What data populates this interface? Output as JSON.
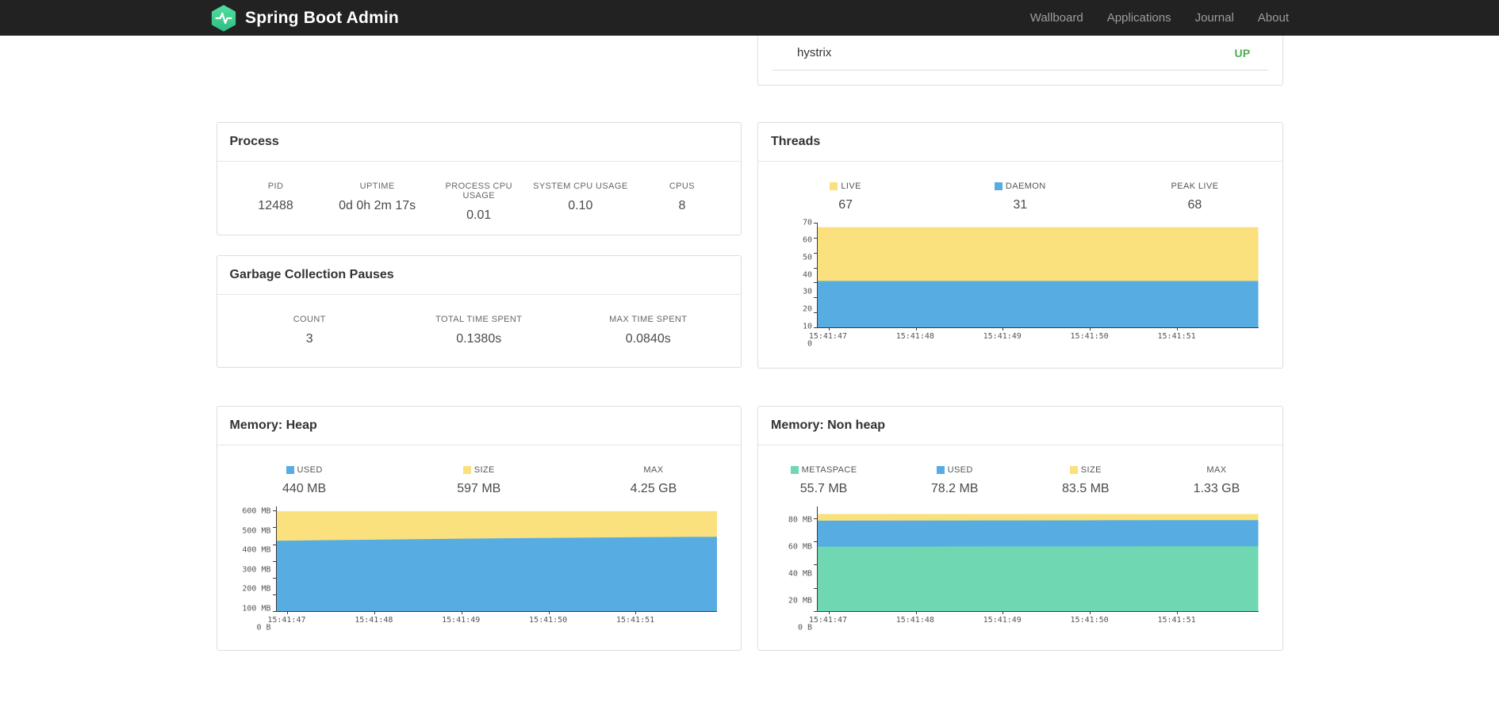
{
  "navbar": {
    "brand": "Spring Boot Admin",
    "logo_color_top": "#4ede9e",
    "logo_color_bottom": "#2fbf83",
    "items": [
      {
        "label": "Wallboard"
      },
      {
        "label": "Applications"
      },
      {
        "label": "Journal"
      },
      {
        "label": "About"
      }
    ]
  },
  "application_panel": {
    "app_name": "hystrix",
    "status": "UP",
    "status_color": "#4caf50"
  },
  "process": {
    "title": "Process",
    "stats": [
      {
        "label": "PID",
        "value": "12488"
      },
      {
        "label": "UPTIME",
        "value": "0d 0h 2m 17s"
      },
      {
        "label": "PROCESS CPU USAGE",
        "value": "0.01"
      },
      {
        "label": "SYSTEM CPU USAGE",
        "value": "0.10"
      },
      {
        "label": "CPUS",
        "value": "8"
      }
    ]
  },
  "gc": {
    "title": "Garbage Collection Pauses",
    "stats": [
      {
        "label": "COUNT",
        "value": "3"
      },
      {
        "label": "TOTAL TIME SPENT",
        "value": "0.1380s"
      },
      {
        "label": "MAX TIME SPENT",
        "value": "0.0840s"
      }
    ]
  },
  "threads": {
    "title": "Threads",
    "legend": [
      {
        "label": "LIVE",
        "value": "67",
        "color": "#fae17d"
      },
      {
        "label": "DAEMON",
        "value": "31",
        "color": "#57ace2"
      },
      {
        "label": "PEAK LIVE",
        "value": "68"
      }
    ]
  },
  "memory_heap": {
    "title": "Memory: Heap",
    "legend": [
      {
        "label": "USED",
        "value": "440 MB",
        "color": "#57ace2"
      },
      {
        "label": "SIZE",
        "value": "597 MB",
        "color": "#fae17d"
      },
      {
        "label": "MAX",
        "value": "4.25 GB"
      }
    ]
  },
  "memory_nonheap": {
    "title": "Memory: Non heap",
    "legend": [
      {
        "label": "METASPACE",
        "value": "55.7 MB",
        "color": "#6fd8b2"
      },
      {
        "label": "USED",
        "value": "78.2 MB",
        "color": "#57ace2"
      },
      {
        "label": "SIZE",
        "value": "83.5 MB",
        "color": "#fae17d"
      },
      {
        "label": "MAX",
        "value": "1.33 GB"
      }
    ]
  },
  "chart_data": [
    {
      "id": "threads",
      "type": "area",
      "title": "Threads",
      "stacked": true,
      "legend_position": "top",
      "grid": false,
      "y_max": 70,
      "y_ticks": [
        {
          "label": "0",
          "value": 0
        },
        {
          "label": "10",
          "value": 10
        },
        {
          "label": "20",
          "value": 20
        },
        {
          "label": "30",
          "value": 30
        },
        {
          "label": "40",
          "value": 40
        },
        {
          "label": "50",
          "value": 50
        },
        {
          "label": "60",
          "value": 60
        },
        {
          "label": "70",
          "value": 70
        }
      ],
      "x_tick_labels": [
        "15:41:47",
        "15:41:48",
        "15:41:49",
        "15:41:50",
        "15:41:51"
      ],
      "x_tick_positions": [
        0.025,
        0.2225,
        0.42,
        0.6175,
        0.815
      ],
      "series": [
        {
          "name": "DAEMON",
          "color": "#57ace2",
          "values": [
            31,
            31,
            31,
            31,
            31,
            31
          ]
        },
        {
          "name": "LIVE",
          "color": "#fae17d",
          "values": [
            67,
            67,
            67,
            67,
            67,
            67
          ]
        }
      ]
    },
    {
      "id": "memory-heap",
      "type": "area",
      "title": "Memory: Heap",
      "stacked": true,
      "legend_position": "top",
      "grid": false,
      "y_max": 625,
      "y_ticks": [
        {
          "label": "0 B",
          "value": 0
        },
        {
          "label": "100 MB",
          "value": 100
        },
        {
          "label": "200 MB",
          "value": 200
        },
        {
          "label": "300 MB",
          "value": 300
        },
        {
          "label": "400 MB",
          "value": 400
        },
        {
          "label": "500 MB",
          "value": 500
        },
        {
          "label": "600 MB",
          "value": 600
        }
      ],
      "x_tick_labels": [
        "15:41:47",
        "15:41:48",
        "15:41:49",
        "15:41:50",
        "15:41:51"
      ],
      "x_tick_positions": [
        0.025,
        0.2225,
        0.42,
        0.6175,
        0.815
      ],
      "series": [
        {
          "name": "USED",
          "color": "#57ace2",
          "values": [
            420,
            426,
            432,
            437,
            441,
            444
          ]
        },
        {
          "name": "SIZE",
          "color": "#fae17d",
          "values": [
            597,
            597,
            597,
            597,
            597,
            597
          ]
        }
      ]
    },
    {
      "id": "memory-nonheap",
      "type": "area",
      "title": "Memory: Non heap",
      "stacked": true,
      "legend_position": "top",
      "grid": false,
      "y_max": 90,
      "y_ticks": [
        {
          "label": "0 B",
          "value": 0
        },
        {
          "label": "20 MB",
          "value": 20
        },
        {
          "label": "40 MB",
          "value": 40
        },
        {
          "label": "60 MB",
          "value": 60
        },
        {
          "label": "80 MB",
          "value": 80
        }
      ],
      "x_tick_labels": [
        "15:41:47",
        "15:41:48",
        "15:41:49",
        "15:41:50",
        "15:41:51"
      ],
      "x_tick_positions": [
        0.025,
        0.2225,
        0.42,
        0.6175,
        0.815
      ],
      "series": [
        {
          "name": "METASPACE",
          "color": "#6fd8b2",
          "values": [
            55.4,
            55.5,
            55.6,
            55.6,
            55.7,
            55.7
          ]
        },
        {
          "name": "USED",
          "color": "#57ace2",
          "values": [
            77.8,
            77.9,
            78.0,
            78.1,
            78.2,
            78.2
          ]
        },
        {
          "name": "SIZE",
          "color": "#fae17d",
          "values": [
            83.5,
            83.5,
            83.5,
            83.5,
            83.5,
            83.5
          ]
        }
      ]
    }
  ]
}
